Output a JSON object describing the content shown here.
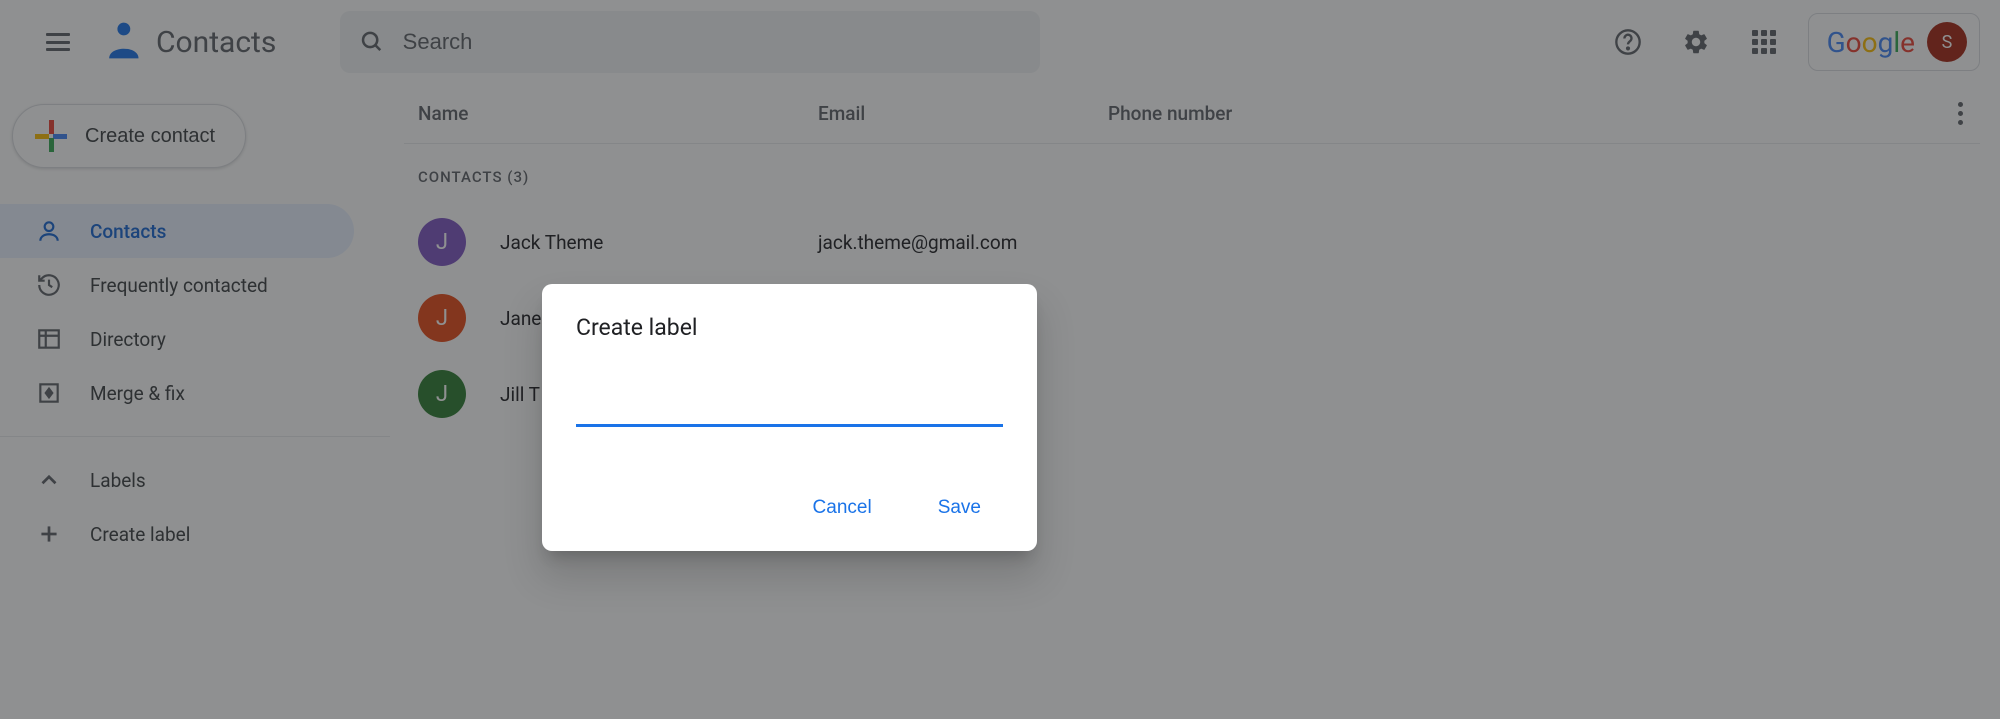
{
  "header": {
    "app_title": "Contacts",
    "search_placeholder": "Search",
    "google_logo_text": "Google",
    "avatar_initial": "S"
  },
  "sidebar": {
    "create_contact_label": "Create contact",
    "items": [
      {
        "label": "Contacts"
      },
      {
        "label": "Frequently contacted"
      },
      {
        "label": "Directory"
      },
      {
        "label": "Merge & fix"
      }
    ],
    "labels_header": "Labels",
    "create_label": "Create label"
  },
  "table": {
    "col_name": "Name",
    "col_email": "Email",
    "col_phone": "Phone number",
    "section_label": "CONTACTS (3)"
  },
  "contacts": [
    {
      "initial": "J",
      "name": "Jack Theme",
      "email": "jack.theme@gmail.com",
      "color": "#7e57c2"
    },
    {
      "initial": "J",
      "name": "Jane",
      "email": "",
      "color": "#e64a19"
    },
    {
      "initial": "J",
      "name": "Jill T",
      "email": "",
      "color": "#2e7d32"
    }
  ],
  "dialog": {
    "title": "Create label",
    "input_value": "",
    "cancel_label": "Cancel",
    "save_label": "Save"
  }
}
